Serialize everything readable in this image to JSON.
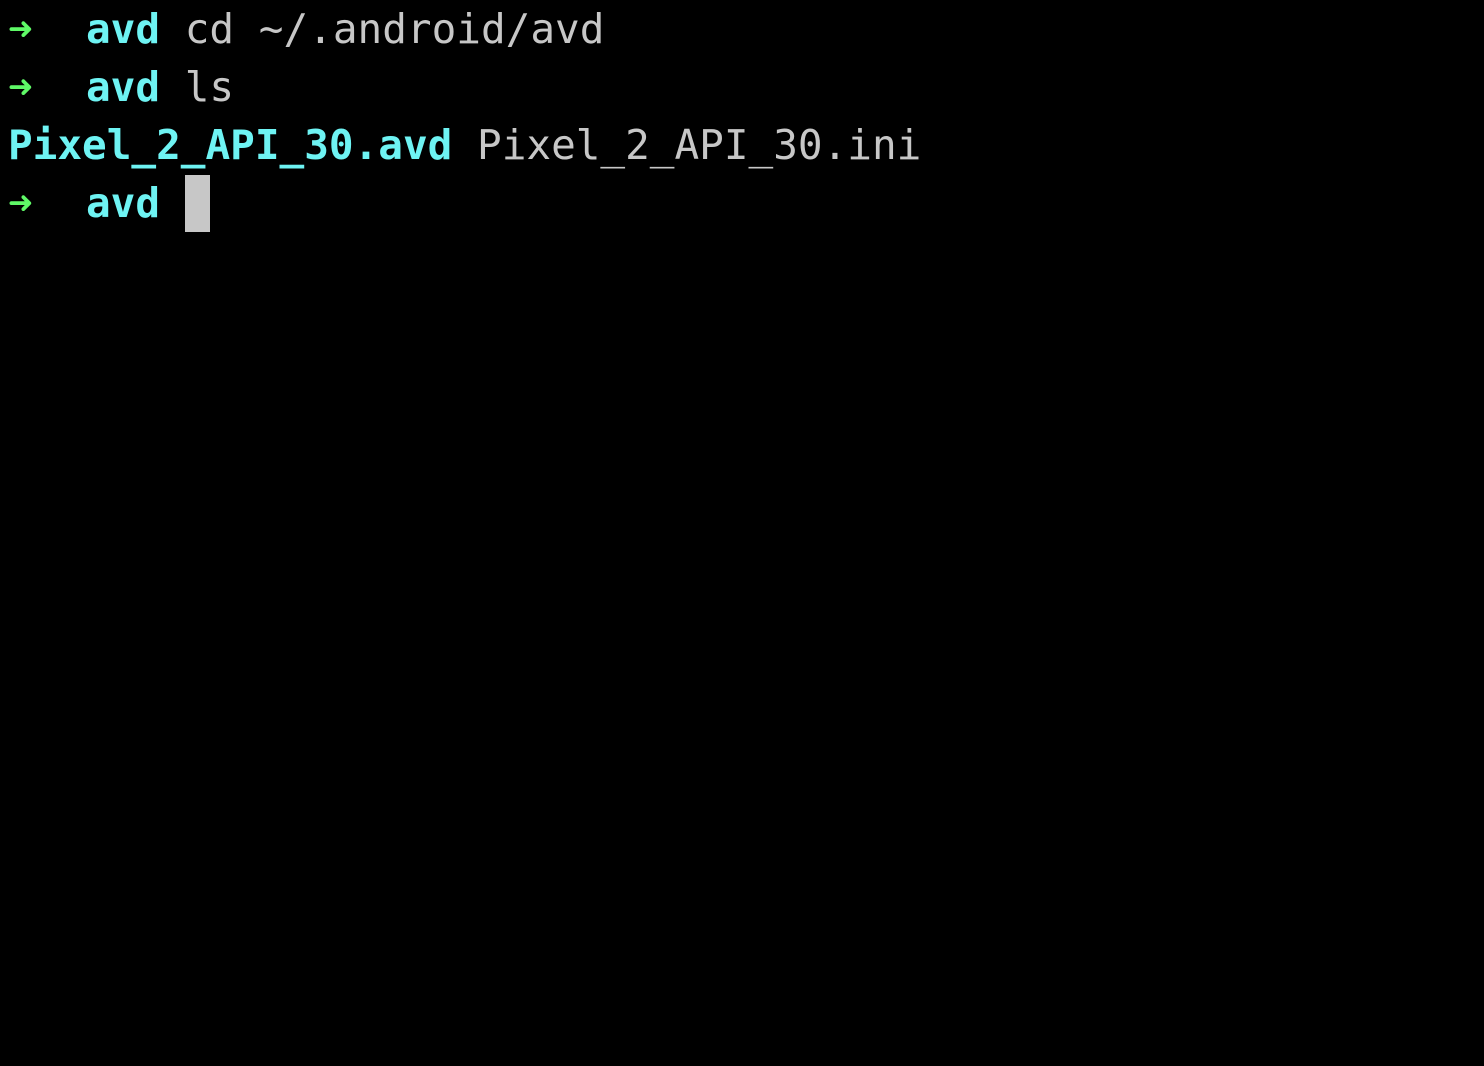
{
  "prompt": {
    "symbol": "➜",
    "cwd": "avd"
  },
  "history": [
    {
      "cwd": "avd",
      "command": "cd ~/.android/avd"
    },
    {
      "cwd": "avd",
      "command": "ls"
    }
  ],
  "ls_output": {
    "directory": "Pixel_2_API_30.avd",
    "file": "Pixel_2_API_30.ini"
  },
  "current_prompt": {
    "cwd": "avd",
    "input": ""
  },
  "colors": {
    "background": "#000000",
    "prompt_arrow": "#5ff967",
    "prompt_dir": "#6ef3f3",
    "text": "#c7c7c7",
    "cursor": "#c7c7c7"
  }
}
